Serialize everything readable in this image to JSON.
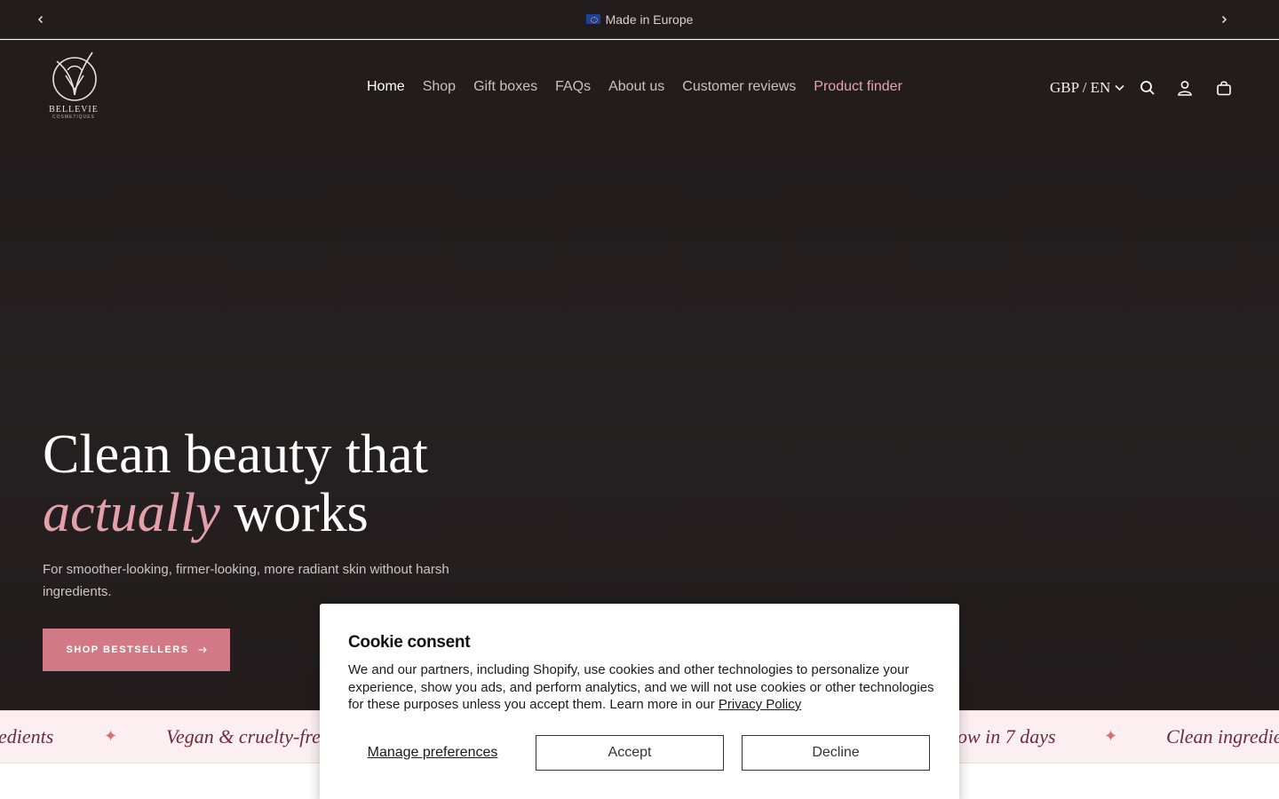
{
  "announcement": {
    "flag_icon": "eu-flag-icon",
    "text": "Made in Europe",
    "prev_icon": "chevron-left-icon",
    "next_icon": "chevron-right-icon"
  },
  "header": {
    "logo": {
      "brand": "BELLEVIE",
      "sub": "COSMETIQUES"
    },
    "nav": [
      {
        "label": "Home"
      },
      {
        "label": "Shop"
      },
      {
        "label": "Gift boxes"
      },
      {
        "label": "FAQs"
      },
      {
        "label": "About us"
      },
      {
        "label": "Customer reviews"
      },
      {
        "label": "Product finder"
      }
    ],
    "currency_label": "GBP / EN",
    "icons": [
      "search-icon",
      "account-icon",
      "cart-icon"
    ]
  },
  "hero": {
    "title_line1": "Clean beauty that",
    "title_em": "actually",
    "title_rest": " works",
    "subtitle": "For smoother-looking, firmer-looking, more radiant skin without harsh ingredients.",
    "cta_label": "SHOP BESTSELLERS"
  },
  "marquee": {
    "items": [
      "edients",
      "Vegan & cruelty-free",
      "ow in 7 days",
      "Clean ingredie"
    ]
  },
  "cookie": {
    "title": "Cookie consent",
    "text_before": "We and our partners, including Shopify, use cookies and other technologies to personalize your experience, show you ads, and perform analytics, and we will not use cookies or other technologies for these purposes unless you accept them. Learn more in our ",
    "link_label": "Privacy Policy",
    "manage_label": "Manage preferences",
    "accept_label": "Accept",
    "decline_label": "Decline"
  },
  "colors": {
    "background_dark": "#221c1d",
    "accent_pink": "#d17a85",
    "highlight_pink": "#e3a0a9",
    "marquee_bg": "#fbeff1",
    "marquee_text": "#6d2b3a"
  }
}
